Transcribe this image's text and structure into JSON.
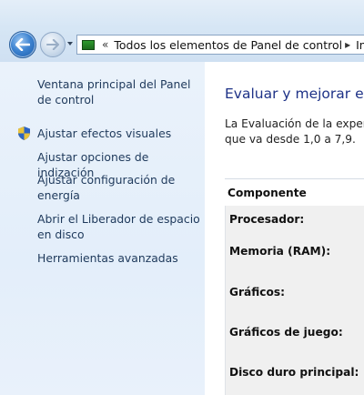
{
  "address": {
    "breadcrumb": "Todos los elementos de Panel de control",
    "next_crumb": "Info"
  },
  "sidebar": {
    "items": [
      {
        "label": "Ventana principal del Panel de control"
      },
      {
        "label": "Ajustar efectos visuales",
        "icon": "uac-shield-icon"
      },
      {
        "label": "Ajustar opciones de indización"
      },
      {
        "label": "Ajustar configuración de energía"
      },
      {
        "label": "Abrir el Liberador de espacio en disco"
      },
      {
        "label": "Herramientas avanzadas"
      }
    ]
  },
  "main": {
    "title": "Evaluar y mejorar el r",
    "description_line1": "La Evaluación de la experie",
    "description_line2": "que va desde 1,0 a 7,9.",
    "table": {
      "header": "Componente",
      "rows": [
        "Procesador:",
        "Memoria (RAM):",
        "Gráficos:",
        "Gráficos de juego:",
        "Disco duro principal:"
      ]
    }
  },
  "colors": {
    "link": "#1e395b",
    "heading": "#1e3287",
    "pane_bg": "#e5eff9"
  }
}
